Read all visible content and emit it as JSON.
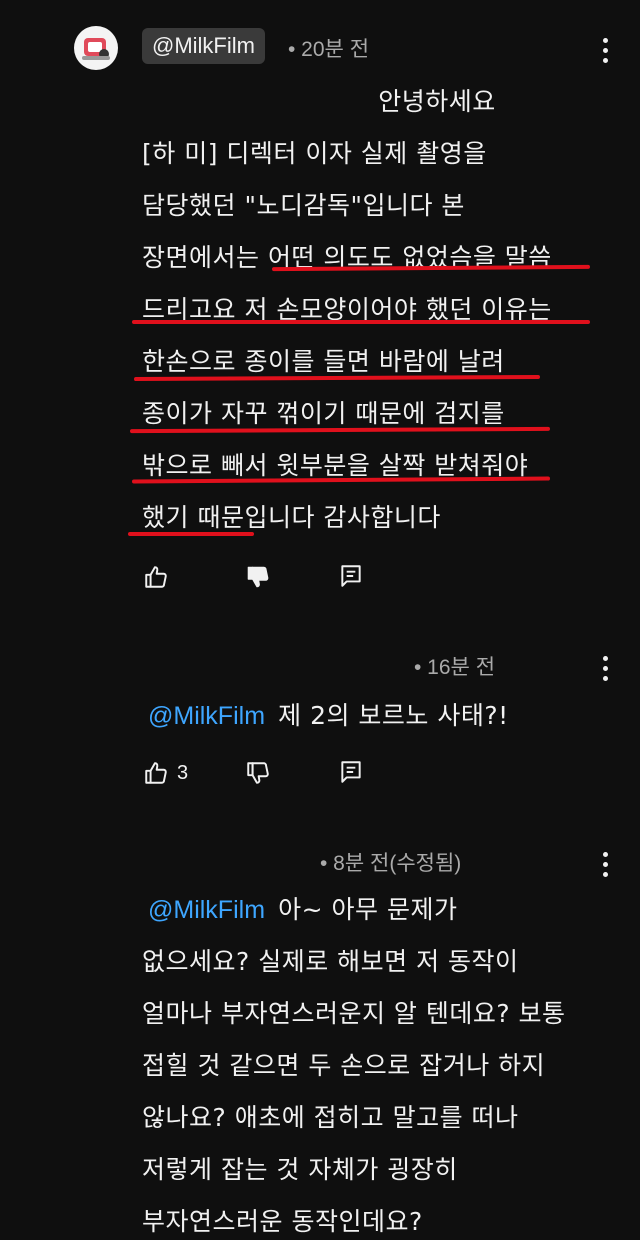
{
  "comment1": {
    "handle": "@MilkFilm",
    "time": "• 20분 전",
    "lines": [
      "안녕하세요",
      "[하   미] 디렉터 이자 실제 촬영을",
      "담당했던 \"노디감독\"입니다 본",
      "장면에서는 어떤 의도도 없었슴을 말씀",
      "드리고요 저 손모양이어야 했던 이유는",
      "한손으로 종이를 들면 바람에 날려",
      "종이가 자꾸 꺾이기 때문에  검지를",
      "밖으로 빼서 윗부분을 살짝 받쳐줘야",
      "했기 때문입니다 감사합니다"
    ]
  },
  "reply1": {
    "time": "• 16분 전",
    "mention": "@MilkFilm",
    "text": "제 2의 보르노 사태?!",
    "likes": "3"
  },
  "reply2": {
    "time": "• 8분 전(수정됨)",
    "mention": "@MilkFilm",
    "first_line": "아~ 아무 문제가",
    "lines": [
      "없으세요? 실제로 해보면 저 동작이",
      "얼마나 부자연스러운지 알 텐데요? 보통",
      "접힐 것 같으면 두 손으로 잡거나 하지",
      "않나요? 애초에 접히고 말고를 떠나",
      "저렇게 잡는 것 자체가 굉장히",
      "부자연스러운 동작인데요?"
    ]
  },
  "icons": {
    "like": "thumbs-up-icon",
    "dislike": "thumbs-down-icon",
    "reply": "reply-icon",
    "more": "more-vert-icon"
  },
  "colors": {
    "background": "#0f0f0f",
    "text": "#f1f1f1",
    "meta": "#aaaaaa",
    "mention": "#3ea6ff",
    "underline": "#e0101c"
  }
}
